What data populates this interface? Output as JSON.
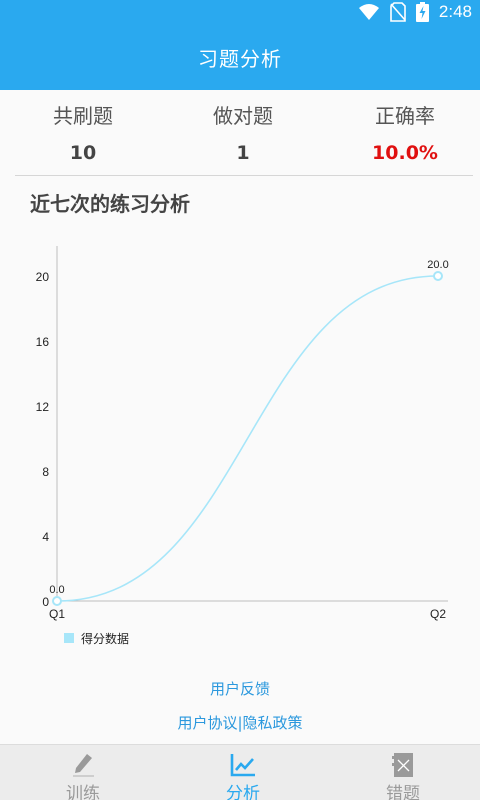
{
  "status_bar": {
    "time": "2:48"
  },
  "header": {
    "title": "习题分析"
  },
  "stats": [
    {
      "label": "共刷题",
      "value": "10"
    },
    {
      "label": "做对题",
      "value": "1"
    },
    {
      "label": "正确率",
      "value": "10.0%"
    }
  ],
  "section": {
    "title": "近七次的练习分析"
  },
  "chart_data": {
    "type": "line",
    "categories": [
      "Q1",
      "Q2"
    ],
    "series": [
      {
        "name": "得分数据",
        "values": [
          0.0,
          20.0
        ],
        "color": "#a7e6f9"
      }
    ],
    "data_labels": [
      "0.0",
      "20.0"
    ],
    "y_ticks": [
      0,
      4,
      8,
      12,
      16,
      20
    ],
    "ylim": [
      0,
      20
    ],
    "grid": false,
    "legend": "bottom-left"
  },
  "links": {
    "feedback": "用户反馈",
    "policy": "用户协议|隐私政策"
  },
  "tabs": [
    {
      "label": "训练",
      "icon": "pencil-icon",
      "active": false
    },
    {
      "label": "分析",
      "icon": "chart-line-icon",
      "active": true
    },
    {
      "label": "错题",
      "icon": "notebook-icon",
      "active": false
    }
  ],
  "colors": {
    "primary": "#2aa9ef",
    "accent_red": "#e01010",
    "link": "#2b98dd",
    "series": "#a7e6f9"
  }
}
